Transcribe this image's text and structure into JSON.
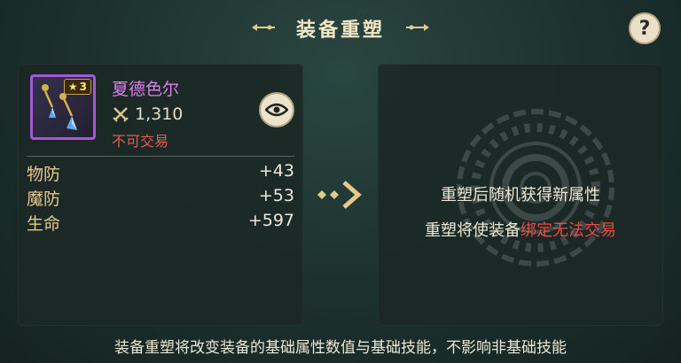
{
  "header": {
    "title": "装备重塑",
    "help_label": "?"
  },
  "item": {
    "name": "夏德色尔",
    "star_level": "3",
    "power": "1,310",
    "trade_status": "不可交易",
    "icon": "earring-icon",
    "rarity_color": "#a457d6"
  },
  "attributes": [
    {
      "name": "物防",
      "value": "+43"
    },
    {
      "name": "魔防",
      "value": "+53"
    },
    {
      "name": "生命",
      "value": "+597"
    }
  ],
  "result": {
    "line1": "重塑后随机获得新属性",
    "line2_prefix": "重塑将使装备",
    "line2_warning": "绑定无法交易"
  },
  "footer_note": "装备重塑将改变装备的基础属性数值与基础技能，不影响非基础技能",
  "colors": {
    "accent_gold": "#e6c98a",
    "warning_red": "#ee4a44",
    "item_name": "#e07ef2"
  }
}
